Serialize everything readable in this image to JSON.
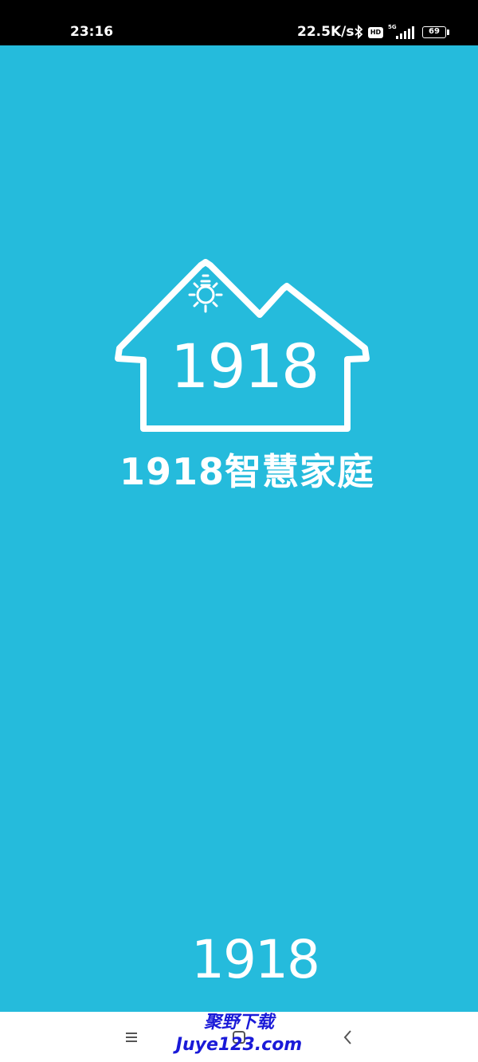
{
  "status_bar": {
    "time": "23:16",
    "network_speed": "22.5K/s",
    "hd_badge": "HD",
    "network_type": "5G",
    "battery_level": "69"
  },
  "splash": {
    "logo_number": "1918",
    "app_title": "1918智慧家庭",
    "footer_logo": "1918",
    "background_color": "#25bbdc"
  },
  "nav_bar": {
    "menu_icon": "menu-icon",
    "home_icon": "home-icon",
    "back_icon": "back-icon"
  },
  "watermark": {
    "line1": "聚野下载",
    "line2": "Juye123.com"
  }
}
